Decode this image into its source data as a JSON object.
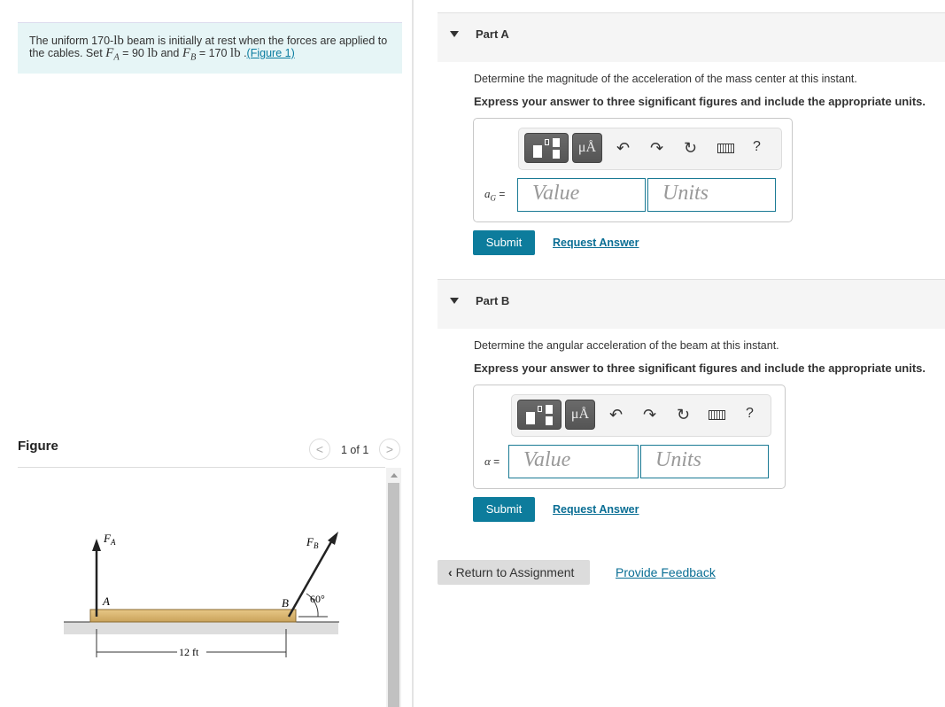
{
  "problem": {
    "text1": "The uniform 170-",
    "unit_lb": "lb",
    "text2": " beam is initially at rest when the forces are applied to the cables. Set ",
    "FA": "F",
    "FA_sub": "A",
    "eq1": " = 90 ",
    "and": " and ",
    "FB": "F",
    "FB_sub": "B",
    "eq2": " = 170 ",
    "dot": " .",
    "figure_link": "(Figure 1)"
  },
  "figure": {
    "label": "Figure",
    "pager": "1 of 1",
    "labels": {
      "FA": "F",
      "FA_sub": "A",
      "FB": "F",
      "FB_sub": "B",
      "A": "A",
      "B": "B",
      "angle": "60°",
      "dist": "12 ft"
    }
  },
  "parts": [
    {
      "title": "Part A",
      "question": "Determine the magnitude of the acceleration of the mass center at this instant.",
      "instruction": "Express your answer to three significant figures and include the appropriate units.",
      "var": "a",
      "var_sub": "G",
      "eq": " =",
      "value_placeholder": "Value",
      "units_placeholder": "Units",
      "submit": "Submit",
      "request": "Request Answer"
    },
    {
      "title": "Part B",
      "question": "Determine the angular acceleration of the beam at this instant.",
      "instruction": "Express your answer to three significant figures and include the appropriate units.",
      "var": "α",
      "var_sub": "",
      "eq": " =",
      "value_placeholder": "Value",
      "units_placeholder": "Units",
      "submit": "Submit",
      "request": "Request Answer"
    }
  ],
  "toolbar": {
    "units_btn": "μÅ",
    "undo": "↶",
    "redo": "↷",
    "reset": "↻",
    "help": "?"
  },
  "footer": {
    "return": "Return to Assignment",
    "feedback": "Provide Feedback"
  },
  "colors": {
    "accent": "#0d7c9c",
    "info_bg": "#e6f5f6"
  }
}
